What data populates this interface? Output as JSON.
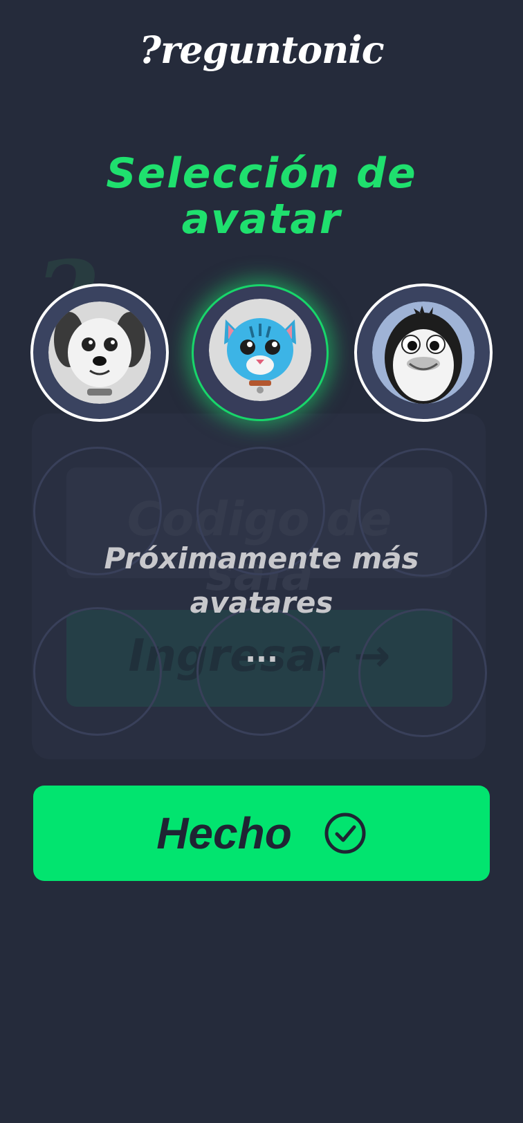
{
  "app": {
    "logo_text": "?reguntonic"
  },
  "header": {
    "title": "Selección de avatar"
  },
  "background": {
    "code_placeholder": "Codigo de sala",
    "enter_label": "Ingresar →"
  },
  "avatars": [
    {
      "name": "dog-avatar",
      "selected": false
    },
    {
      "name": "cat-avatar",
      "selected": true
    },
    {
      "name": "penguin-avatar",
      "selected": false
    }
  ],
  "coming_soon": {
    "text": "Próximamente más avatares",
    "ellipsis": "..."
  },
  "done_button": {
    "label": "Hecho",
    "icon": "check-circle-icon"
  },
  "colors": {
    "accent": "#02e46f",
    "title": "#1fe06e",
    "background": "#252b3b"
  }
}
